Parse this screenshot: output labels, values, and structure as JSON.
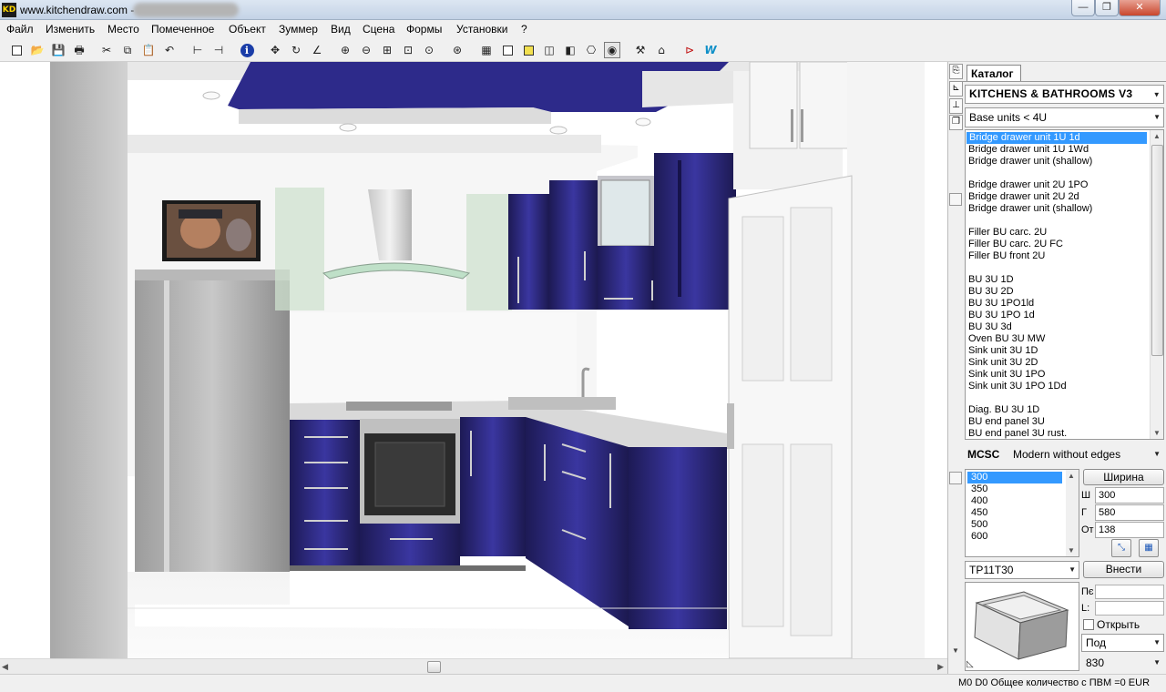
{
  "window": {
    "app_icon_text": "KD",
    "title": "www.kitchendraw.com - ",
    "minimize_glyph": "—",
    "maximize_glyph": "❐",
    "close_glyph": "✕"
  },
  "menu": {
    "items": [
      "Файл",
      "Изменить",
      "Место",
      "Помеченное",
      "Объект",
      "Зуммер",
      "Вид",
      "Сцена",
      "Формы",
      "Установки",
      "?"
    ]
  },
  "toolbar": {
    "icons": [
      "new-file-icon",
      "open-folder-icon",
      "save-icon",
      "print-icon",
      "cut-icon",
      "copy-icon",
      "paste-icon",
      "undo-icon",
      "dimension-icon",
      "measure-icon",
      "info-icon",
      "move-icon",
      "rotate-icon",
      "angle-icon",
      "zoom-in-icon",
      "zoom-out-icon",
      "zoom-window-icon",
      "zoom-all-icon",
      "zoom-previous-icon",
      "view-top-icon",
      "view-plan-icon",
      "wireframe-icon",
      "shaded-icon",
      "box-3d-icon",
      "box-colored-icon",
      "camera-icon",
      "camera-active-icon",
      "render-icon",
      "house-icon",
      "route-icon",
      "web-icon"
    ],
    "glyphs": [
      "□",
      "📂",
      "💾",
      "🖶",
      "✂",
      "⧉",
      "📋",
      "↶",
      "⊢",
      "⊣",
      "i",
      "✥",
      "↻",
      "∠",
      "⊕",
      "⊖",
      "⊞",
      "⊡",
      "⊙",
      "⊛",
      "▦",
      "□",
      "■",
      "◫",
      "◧",
      "⎔",
      "◉",
      "⚒",
      "⌂",
      "⊳",
      "W"
    ],
    "accent_blue": "#1a3da8"
  },
  "status": {
    "text": "M0  D0 Общее количество с ПВМ =0 EUR"
  },
  "panel": {
    "catalog_tab": "Каталог",
    "catalog_name": "KITCHENS & BATHROOMS V3",
    "group": "Base units < 4U",
    "items": [
      "Bridge drawer unit 1U 1d",
      "Bridge drawer unit 1U 1Wd",
      "Bridge drawer unit (shallow)",
      "",
      "Bridge drawer unit 2U 1PO",
      "Bridge drawer unit 2U 2d",
      "Bridge drawer unit (shallow)",
      "",
      "Filler BU carc. 2U",
      "Filler BU carc. 2U FC",
      "Filler BU front 2U",
      "",
      "BU 3U 1D",
      "BU 3U 2D",
      "BU 3U 1PO1ld",
      "BU 3U 1PO 1d",
      "BU 3U 3d",
      "Oven BU 3U MW",
      "Sink unit 3U 1D",
      "Sink unit 3U 2D",
      "Sink unit 3U 1PO",
      "Sink unit 3U 1PO 1Dd",
      "",
      "Diag. BU 3U 1D",
      "BU end panel 3U",
      "BU end panel 3U rust."
    ],
    "selected_item_index": 0,
    "style_code": "MCSC",
    "style_name": "Modern without edges",
    "widths": [
      "300",
      "350",
      "400",
      "450",
      "500",
      "600"
    ],
    "selected_width_index": 0,
    "width_button": "Ширина",
    "dims": [
      {
        "label": "Ш",
        "value": "300"
      },
      {
        "label": "Г",
        "value": "580"
      },
      {
        "label": "От",
        "value": "138"
      }
    ],
    "code": "TP11T30",
    "insert_button": "Внести",
    "pe_label": "Пє",
    "l_label": "L:",
    "open_label": "Открыть",
    "position": "Под",
    "value_830": "830",
    "selection_color": "#3399ff"
  },
  "scene": {
    "cabinet_color": "#242163",
    "ceiling_color": "#2d2a8a"
  }
}
